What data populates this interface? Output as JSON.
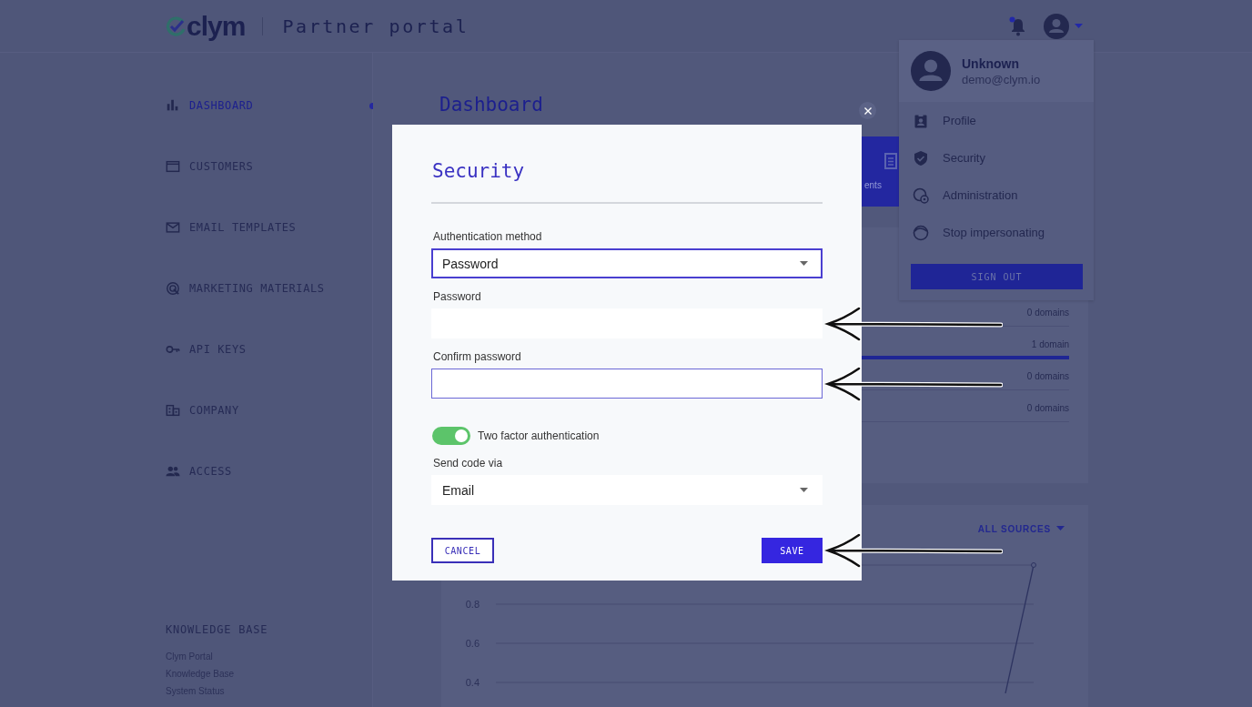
{
  "header": {
    "logo": "clym",
    "portal_title": "Partner portal",
    "notification_dot": true
  },
  "sidebar": {
    "items": [
      {
        "label": "DASHBOARD",
        "selected": true
      },
      {
        "label": "CUSTOMERS",
        "selected": false
      },
      {
        "label": "EMAIL TEMPLATES",
        "selected": false
      },
      {
        "label": "MARKETING MATERIALS",
        "selected": false
      },
      {
        "label": "API KEYS",
        "selected": false
      },
      {
        "label": "COMPANY",
        "selected": false
      },
      {
        "label": "ACCESS",
        "selected": false
      }
    ],
    "knowledge_base": {
      "title": "KNOWLEDGE BASE",
      "links": [
        "Clym Portal",
        "Knowledge Base",
        "System Status"
      ]
    }
  },
  "main": {
    "title": "Dashboard",
    "summary_card": {
      "label": "ents"
    },
    "domain_rows": [
      {
        "reading": "0 domains",
        "level": 0
      },
      {
        "reading": "1 domain",
        "level": 1
      },
      {
        "reading": "0 domains",
        "level": 0
      },
      {
        "reading": "0 domains",
        "level": 0
      }
    ],
    "chart_card": {
      "filter": "ALL SOURCES",
      "y_axis_labels": [
        "0.8",
        "0.6",
        "0.4"
      ]
    }
  },
  "user_menu": {
    "name": "Unknown",
    "email": "demo@clym.io",
    "items": [
      {
        "label": "Profile"
      },
      {
        "label": "Security"
      },
      {
        "label": "Administration"
      },
      {
        "label": "Stop impersonating"
      }
    ],
    "sign_out": "SIGN OUT"
  },
  "modal": {
    "title": "Security",
    "fields": [
      {
        "kind": "select",
        "label": "Authentication method",
        "value": "Password",
        "focused": true,
        "arrow": false
      },
      {
        "kind": "input",
        "label": "Password",
        "focused": false,
        "arrow": true
      },
      {
        "kind": "input",
        "label": "Confirm password",
        "focused": true,
        "arrow": true
      },
      {
        "kind": "toggle",
        "label": "Two factor authentication",
        "on": true
      },
      {
        "kind": "select",
        "label": "Send code via",
        "value": "Email",
        "focused": false,
        "arrow": false
      }
    ],
    "buttons": [
      {
        "label": "CANCEL",
        "kind": "outlined",
        "arrow": false
      },
      {
        "label": "SAVE",
        "kind": "primary",
        "arrow": true
      }
    ]
  }
}
